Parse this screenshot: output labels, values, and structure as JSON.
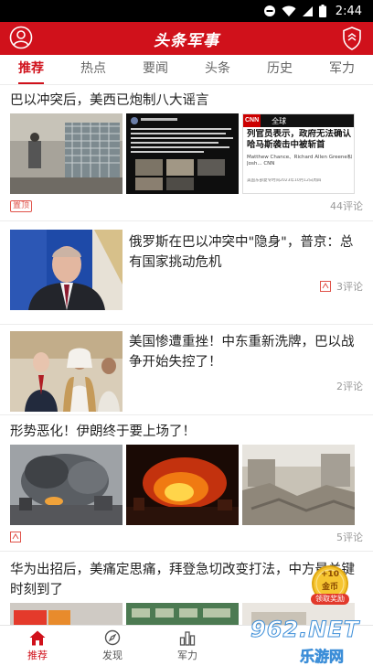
{
  "status_bar": {
    "time": "2:44"
  },
  "app_bar": {
    "title": "头条军事"
  },
  "tabs": [
    {
      "label": "推荐",
      "active": true
    },
    {
      "label": "热点"
    },
    {
      "label": "要闻"
    },
    {
      "label": "头条"
    },
    {
      "label": "历史"
    },
    {
      "label": "军力"
    }
  ],
  "articles": [
    {
      "title": "巴以冲突后，美西已炮制八大谣言",
      "badge": "置顶",
      "comments": "44评论",
      "cnn_overlay": {
        "section": "全球",
        "headline": "列官员表示，政府无法确认哈马斯袭击中被斩首",
        "byline": "Matthew Chance、Richard Allen Greene和Josh... CNN",
        "footer": "美国东部夏令时间2023年10月12日周四"
      }
    },
    {
      "title": "俄罗斯在巴以冲突中\"隐身\"，普京：总有国家挑动危机",
      "comments": "3评论"
    },
    {
      "title": "美国惨遭重挫！中东重新洗牌，巴以战争开始失控了！",
      "comments": "2评论"
    },
    {
      "title": "形势恶化！伊朗终于要上场了！",
      "comments": "5评论"
    },
    {
      "title": "华为出招后，美痛定思痛，拜登急切改变打法，中方最关键时刻到了"
    }
  ],
  "coin_widget": {
    "amount": "+10",
    "unit": "金币",
    "action": "领取奖励"
  },
  "watermark": {
    "brand": "962.NET",
    "sub": "乐游网"
  },
  "bottom_nav": [
    {
      "label": "推荐",
      "active": true,
      "icon": "home-icon"
    },
    {
      "label": "发现",
      "icon": "compass-icon"
    },
    {
      "label": "军力",
      "icon": "bar-chart-icon"
    }
  ],
  "colors": {
    "brand_red": "#d0111b",
    "text": "#222222",
    "meta": "#999999"
  }
}
